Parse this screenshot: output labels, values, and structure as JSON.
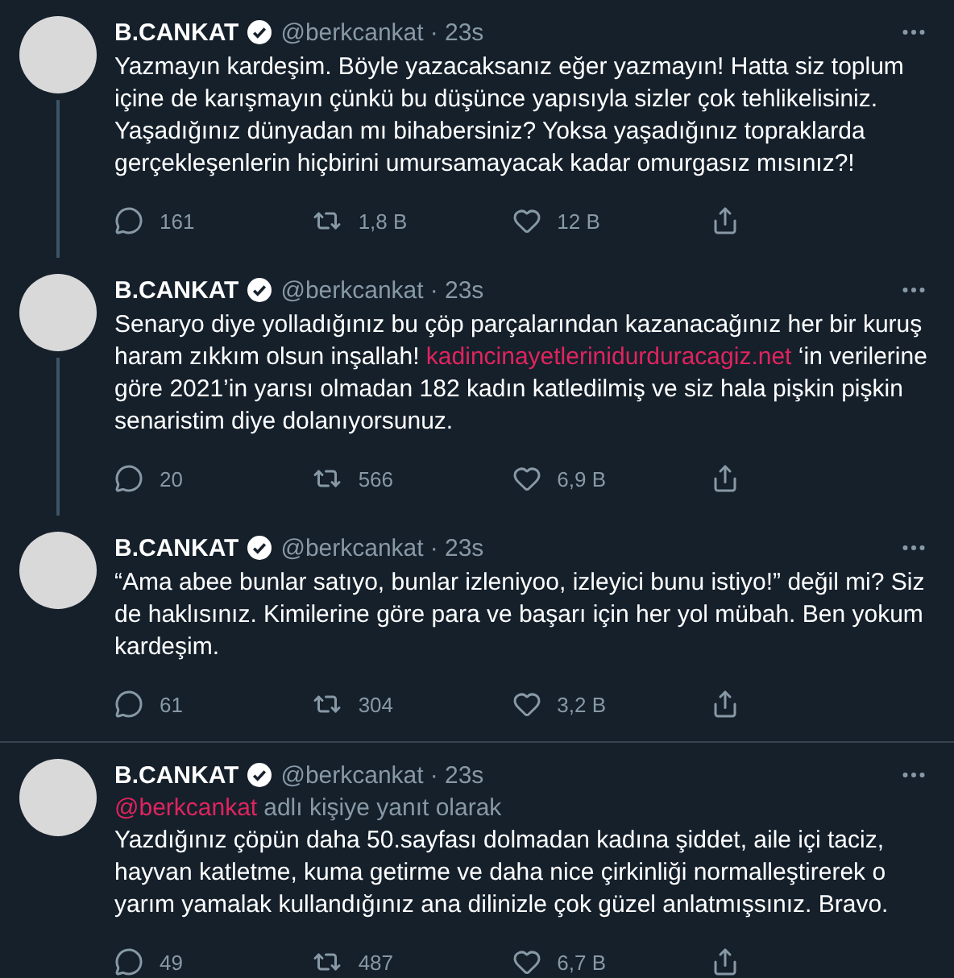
{
  "tweets": [
    {
      "name": "B.CANKAT",
      "handle": "@berkcankat",
      "time": "· 23s",
      "connected": true,
      "body": [
        {
          "kind": "text",
          "text": "Yazmayın kardeşim. Böyle yazacaksanız eğer yazmayın! Hatta siz toplum içine de karışmayın çünkü bu düşünce yapısıyla sizler çok tehlikelisiniz. Yaşadığınız dünyadan mı bihabersiniz? Yoksa yaşadığınız topraklarda gerçekleşenlerin hiçbirini umursamayacak kadar omurgasız mısınız?!"
        }
      ],
      "replies": "161",
      "retweets": "1,8 B",
      "likes": "12 B"
    },
    {
      "name": "B.CANKAT",
      "handle": "@berkcankat",
      "time": "· 23s",
      "connected": true,
      "body": [
        {
          "kind": "text",
          "text": "Senaryo diye yolladığınız bu çöp parçalarından kazanacağınız her bir kuruş haram zıkkım olsun inşallah! "
        },
        {
          "kind": "link",
          "text": "kadincinayetlerinidurduracagiz.net"
        },
        {
          "kind": "text",
          "text": " ‘in verilerine göre 2021’in yarısı olmadan 182 kadın katledilmiş ve siz hala pişkin pişkin senaristim diye dolanıyorsunuz."
        }
      ],
      "replies": "20",
      "retweets": "566",
      "likes": "6,9 B"
    },
    {
      "name": "B.CANKAT",
      "handle": "@berkcankat",
      "time": "· 23s",
      "connected": false,
      "body": [
        {
          "kind": "text",
          "text": "“Ama abee bunlar satıyo, bunlar izleniyoo, izleyici bunu istiyo!” değil mi? Siz de haklısınız. Kimilerine göre para ve başarı için her yol mübah. Ben yokum kardeşim."
        }
      ],
      "replies": "61",
      "retweets": "304",
      "likes": "3,2 B"
    },
    {
      "name": "B.CANKAT",
      "handle": "@berkcankat",
      "time": "· 23s",
      "reply_to": {
        "handle": "@berkcankat",
        "text": "adlı kişiye yanıt olarak"
      },
      "body": [
        {
          "kind": "text",
          "text": "Yazdığınız çöpün daha 50.sayfası dolmadan kadına şiddet, aile içi taciz, hayvan katletme, kuma getirme ve daha nice çirkinliği normalleştirerek o yarım yamalak kullandığınız ana dilinizle çok güzel anlatmışsınız. Bravo."
        }
      ],
      "replies": "49",
      "retweets": "487",
      "likes": "6,7 B"
    }
  ]
}
